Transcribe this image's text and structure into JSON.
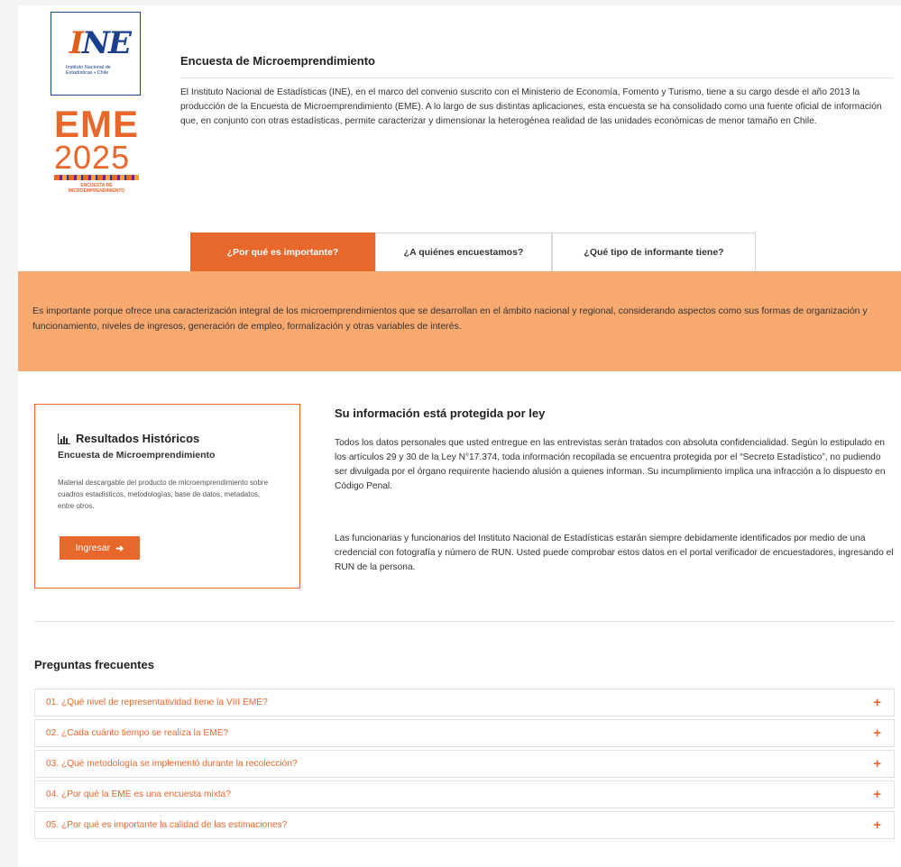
{
  "header": {
    "ine_logo": {
      "mark": "INE",
      "subtitle": "Instituto Nacional de Estadísticas • Chile"
    },
    "eme_logo": {
      "title": "EME",
      "year": "2025",
      "tagline": "ENCUESTA DE MICROEMPRENDIMIENTO"
    },
    "title": "Encuesta de Microemprendimiento",
    "description": "El Instituto Nacional de Estadísticas (INE), en el marco del convenio suscrito con el Ministerio de Economía, Fomento y Turismo, tiene a su cargo desde el año 2013 la producción de la Encuesta de Microemprendimiento (EME). A lo largo de sus distintas aplicaciones, esta encuesta se ha consolidado como una fuente oficial de información que, en conjunto con otras estadísticas, permite caracterizar y dimensionar la heterogénea realidad de las unidades económicas de menor tamaño en Chile."
  },
  "tabs": [
    {
      "label": "¿Por qué es importante?",
      "active": true
    },
    {
      "label": "¿A quiénes encuestamos?",
      "active": false
    },
    {
      "label": "¿Qué tipo de informante tiene?",
      "active": false
    }
  ],
  "tab_content": "Es importante porque ofrece una caracterización integral de los microemprendimientos que se desarrollan en el ámbito nacional y regional, considerando aspectos como sus formas de organización y funcionamiento, niveles de ingresos, generación de empleo, formalización y otras variables de interés.",
  "results": {
    "icon": "bar-chart-icon",
    "title": "Resultados Históricos",
    "subtitle": "Encuesta de Microemprendimiento",
    "description": "Material descargable del producto de microemprendimiento sobre cuadros estadísticos, metodologías, base de datos, metadatos, entre otros.",
    "button_label": "Ingresar",
    "button_icon": "sign-in-icon"
  },
  "protected": {
    "title": "Su información está protegida por ley",
    "paragraph1": "Todos los datos personales que usted entregue en las entrevistas serán tratados con absoluta confidencialidad. Según lo estipulado en los artículos 29 y 30 de la Ley N°17.374, toda información recopilada se encuentra protegida por el “Secreto Estadístico”, no pudiendo ser divulgada por el órgano requirente haciendo alusión a quienes informan. Su incumplimiento implica una infracción a lo dispuesto en Código Penal.",
    "paragraph2": "Las funcionarias y funcionarios del Instituto Nacional de Estadísticas estarán siempre debidamente identificados por medio de una credencial con fotografía y número de RUN. Usted puede comprobar estos datos en el portal verificador de encuestadores, ingresando el RUN de la persona."
  },
  "faq": {
    "title": "Preguntas frecuentes",
    "items": [
      "01. ¿Qué nivel de representatividad tiene la VIII EME?",
      "02. ¿Cada cuánto tiempo se realiza la EME?",
      "03. ¿Qué metodología se implementó durante la recolección?",
      "04. ¿Por qué la EME es una encuesta mixta?",
      "05. ¿Por qué es importante la calidad de las estimaciones?"
    ],
    "expand_symbol": "+"
  },
  "colors": {
    "accent": "#e8672b",
    "panel": "#f8a970",
    "ine_blue": "#1a3f8c"
  }
}
